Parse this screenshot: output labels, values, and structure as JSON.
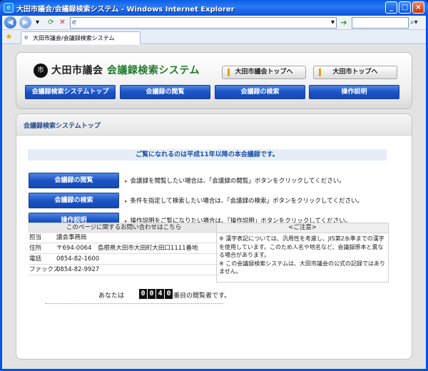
{
  "window": {
    "title": "大田市議会/会議録検索システム - Windows Internet Explorer",
    "tab_label": "大田市議会/会議録検索システム",
    "address_value": "",
    "search_value": ""
  },
  "site": {
    "logo_prefix": "大田市議会 ",
    "logo_main": "会議録検索システム",
    "header_links": [
      "大田市議会トップへ",
      "大田市トップへ"
    ],
    "menu": [
      "会議録検索システムトップ",
      "会議録の閲覧",
      "会議録の検索",
      "操作説明"
    ]
  },
  "main": {
    "title": "会議録検索システムトップ",
    "notice": "ご覧になれるのは平成11年以降の本会議録です。",
    "actions": [
      {
        "label": "会議録の閲覧",
        "desc": "会議録を閲覧したい場合は、「会議録の閲覧」ボタンをクリックしてください。"
      },
      {
        "label": "会議録の検索",
        "desc": "条件を指定して検索したい場合は、「会議録の検索」ボタンをクリックしてください。"
      },
      {
        "label": "操作説明",
        "desc": "操作説明をご覧になりたい場合は、「操作説明」ボタンをクリックしてください。"
      }
    ],
    "contact": {
      "heading": "このページに関するお問い合わせはこちら",
      "rows": [
        {
          "k": "担当",
          "v": "議会事務局"
        },
        {
          "k": "住所",
          "v": "〒694-0064　島根県大田市大田町大田口1111番地"
        },
        {
          "k": "電話",
          "v": "0854-82-1600"
        },
        {
          "k": "ファックス",
          "v": "0854-82-9927"
        }
      ]
    },
    "caution": {
      "heading": "<ご注意>",
      "lines": [
        "※ 漢字表記については、汎用性を考慮し、JIS第2水準までの漢字を使用しています。このため人名や地名など、会議録原本と異なる場合があります。",
        "※ この会議録検索システムは、大田市議会の公式の記録ではありません。"
      ]
    },
    "counter": {
      "prefix": "あなたは",
      "digits": [
        "0",
        "0",
        "4",
        "0"
      ],
      "suffix": "番目の閲覧者です。"
    }
  }
}
